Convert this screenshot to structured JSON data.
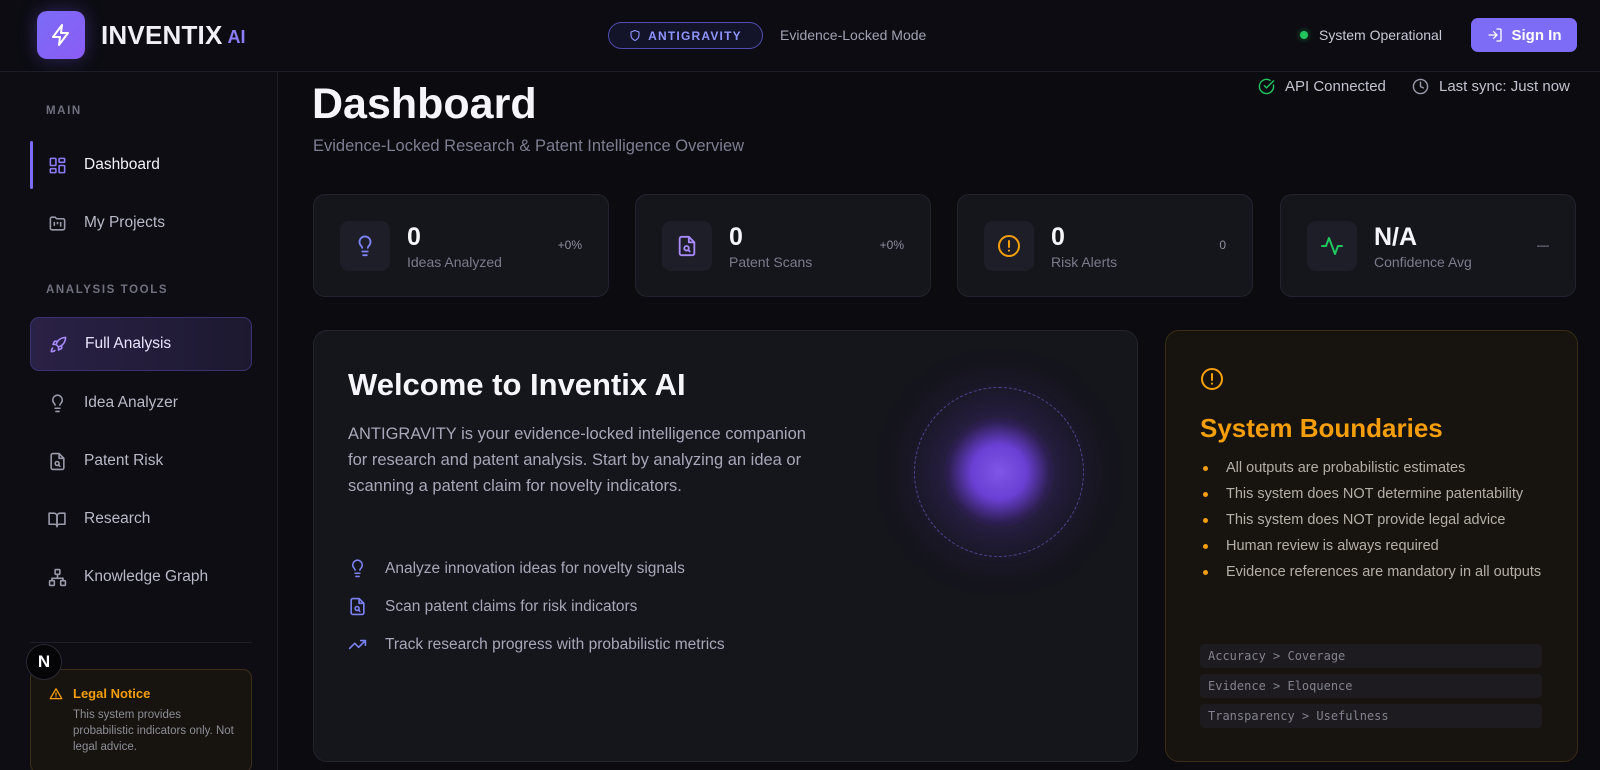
{
  "header": {
    "brand_name": "INVENTIX",
    "brand_suffix": "AI",
    "mode_badge": "ANTIGRAVITY",
    "mode_text": "Evidence-Locked Mode",
    "system_status": "System Operational",
    "signin_label": "Sign In"
  },
  "sidebar": {
    "section_main": "MAIN",
    "section_tools": "ANALYSIS TOOLS",
    "items": [
      {
        "label": "Dashboard"
      },
      {
        "label": "My Projects"
      },
      {
        "label": "Full Analysis"
      },
      {
        "label": "Idea Analyzer"
      },
      {
        "label": "Patent Risk"
      },
      {
        "label": "Research"
      },
      {
        "label": "Knowledge Graph"
      }
    ],
    "legal_title": "Legal Notice",
    "legal_body": "This system provides probabilistic indicators only. Not legal advice.",
    "badge_letter": "N"
  },
  "main": {
    "title": "Dashboard",
    "subtitle": "Evidence-Locked Research & Patent Intelligence Overview",
    "api_status": "API Connected",
    "last_sync": "Last sync: Just now",
    "stats": [
      {
        "value": "0",
        "label": "Ideas Analyzed",
        "delta": "+0%"
      },
      {
        "value": "0",
        "label": "Patent Scans",
        "delta": "+0%"
      },
      {
        "value": "0",
        "label": "Risk Alerts",
        "delta": "0"
      },
      {
        "value": "N/A",
        "label": "Confidence Avg",
        "delta": "—"
      }
    ],
    "welcome": {
      "title": "Welcome to Inventix AI",
      "body": "ANTIGRAVITY is your evidence-locked intelligence companion for research and patent analysis. Start by analyzing an idea or scanning a patent claim for novelty indicators.",
      "features": [
        "Analyze innovation ideas for novelty signals",
        "Scan patent claims for risk indicators",
        "Track research progress with probabilistic metrics"
      ]
    },
    "boundaries": {
      "title": "System Boundaries",
      "items": [
        "All outputs are probabilistic estimates",
        "This system does NOT determine patentability",
        "This system does NOT provide legal advice",
        "Human review is always required",
        "Evidence references are mandatory in all outputs"
      ],
      "principles": [
        "Accuracy > Coverage",
        "Evidence > Eloquence",
        "Transparency > Usefulness"
      ]
    }
  },
  "colors": {
    "accent": "#7c6cf6",
    "warning": "#f59e0b",
    "success": "#22c55e",
    "background": "#0b0b10"
  },
  "icons": {
    "brand": "lightning-bolt-icon",
    "mode": "shield-icon",
    "signin": "log-in-icon",
    "api": "check-circle-icon",
    "sync": "clock-icon"
  }
}
